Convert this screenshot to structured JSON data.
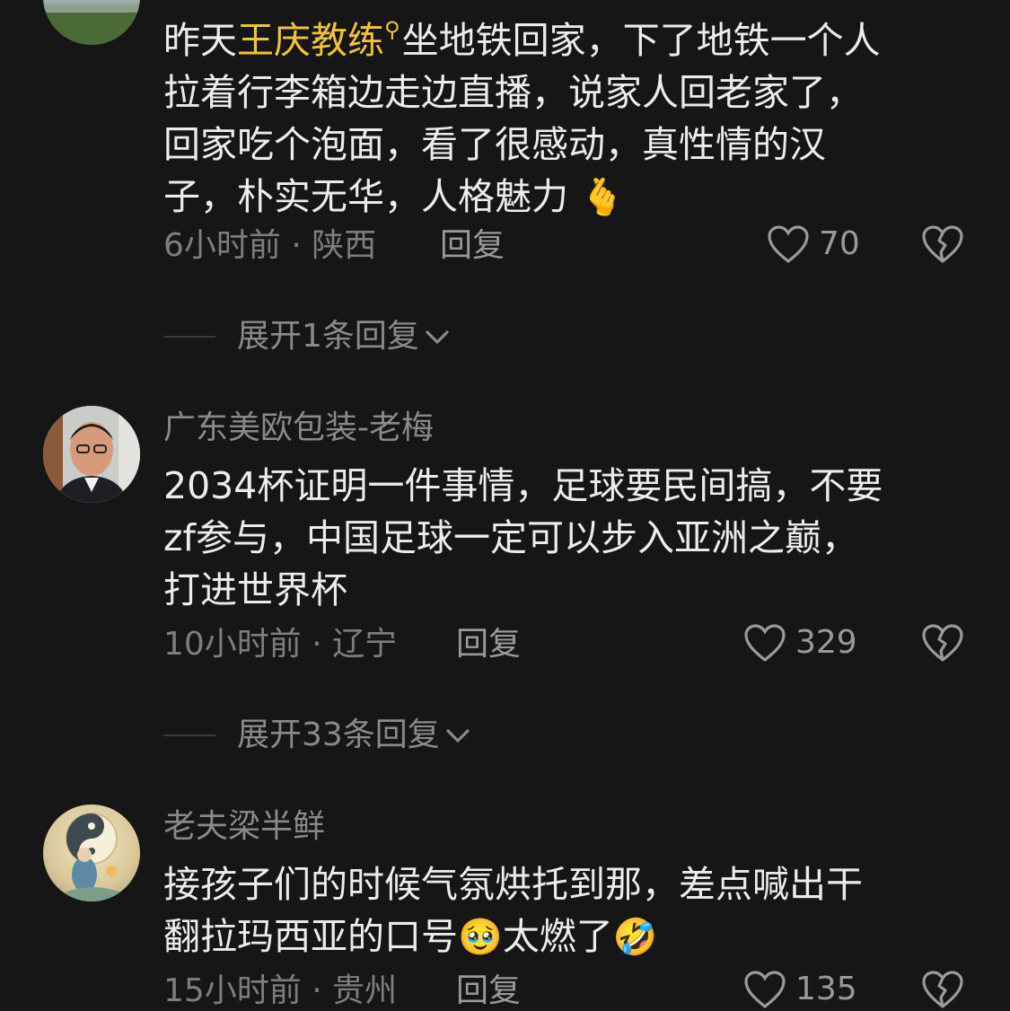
{
  "comments": [
    {
      "username": "",
      "text_prefix": "昨天",
      "mention": "王庆教练",
      "line1_rest": "坐地铁回家，下了地铁一个人",
      "line2": "拉着行李箱边走边直播，说家人回老家了，",
      "line3": "回家吃个泡面，看了很感动，真性情的汉",
      "line4": "子，朴实无华，人格魅力",
      "emoji": "🫰",
      "time_location": "6小时前 · 陕西",
      "reply_label": "回复",
      "likes": "70",
      "expand_label": "展开1条回复"
    },
    {
      "username": "广东美欧包装-老梅",
      "line1": "2034杯证明一件事情，足球要民间搞，不要",
      "line2": "zf参与，中国足球一定可以步入亚洲之巅，",
      "line3": "打进世界杯",
      "time_location": "10小时前 · 辽宁",
      "reply_label": "回复",
      "likes": "329",
      "expand_label": "展开33条回复"
    },
    {
      "username": "老夫梁半鲜",
      "line1": "接孩子们的时候气氛烘托到那，差点喊出干",
      "line2_part1": "翻拉玛西亚的口号",
      "emoji1": "🥹",
      "line2_part2": "太燃了",
      "emoji2": "🤣",
      "time_location": "15小时前 · 贵州",
      "reply_label": "回复",
      "likes": "135"
    }
  ],
  "colors": {
    "background": "#161616",
    "text": "#ececec",
    "muted": "#7e7e7e",
    "mention": "#f0c434"
  },
  "icons": [
    "heart-outline-icon",
    "broken-heart-icon",
    "chevron-down-icon",
    "search-icon"
  ]
}
